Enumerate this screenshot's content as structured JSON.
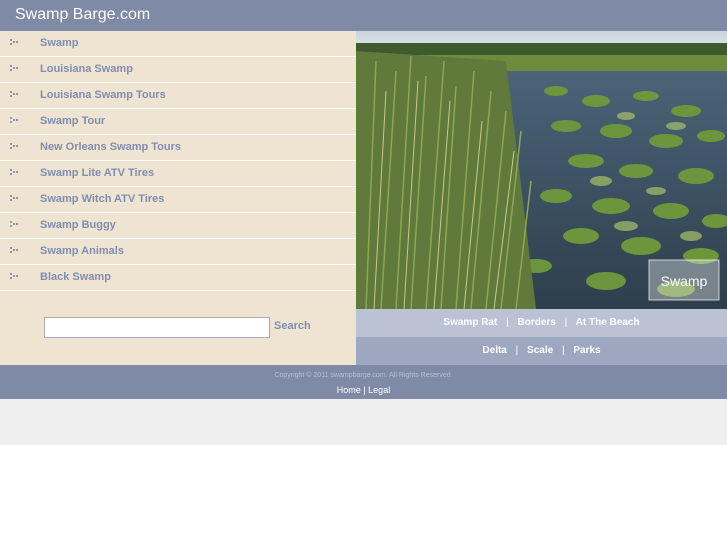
{
  "header": {
    "title": "Swamp Barge.com"
  },
  "nav": {
    "items": [
      {
        "label": "Swamp"
      },
      {
        "label": "Louisiana Swamp"
      },
      {
        "label": "Louisiana Swamp Tours"
      },
      {
        "label": "Swamp Tour"
      },
      {
        "label": "New Orleans Swamp Tours"
      },
      {
        "label": "Swamp Lite ATV Tires"
      },
      {
        "label": "Swamp Witch ATV Tires"
      },
      {
        "label": "Swamp Buggy"
      },
      {
        "label": "Swamp Animals"
      },
      {
        "label": "Black Swamp"
      }
    ]
  },
  "search": {
    "value": "",
    "button_label": "Search"
  },
  "hero": {
    "watermark": "Swamp"
  },
  "links_row1": [
    "Swamp Rat",
    "Borders",
    "At The Beach"
  ],
  "links_row2": [
    "Delta",
    "Scale",
    "Parks"
  ],
  "separator": "|",
  "footer": {
    "copyright": "Copyright © 2011 swampbarge.com. All Rights Reserved.",
    "links": [
      "Home",
      "Legal"
    ]
  },
  "colors": {
    "header_bg": "#7e8aa6",
    "sidebar_bg": "#efe4d1",
    "nav_text": "#7f8eb0",
    "link_bar_light": "#bbc2d3",
    "link_bar_dark": "#9ea7c0"
  }
}
